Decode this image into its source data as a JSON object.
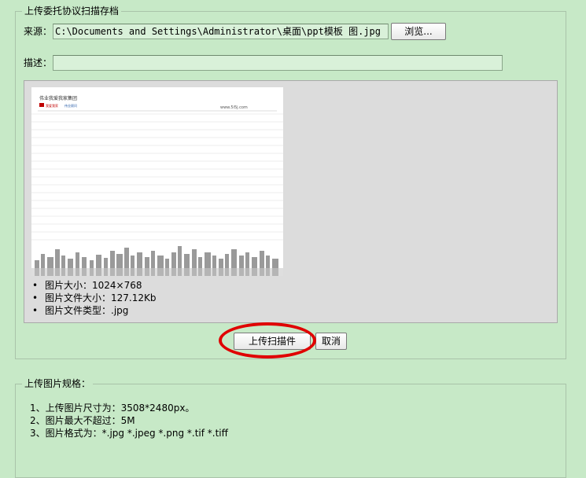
{
  "upload_section": {
    "legend": "上传委托协议扫描存档",
    "source_label": "来源：",
    "source_value": "C:\\Documents and Settings\\Administrator\\桌面\\ppt模板 图.jpg",
    "browse_label": "浏览...",
    "desc_label": "描述：",
    "desc_value": "",
    "preview": {
      "thumbnail": {
        "logo_text": "伟业我爱我家集团",
        "brand_left": "我爱我家",
        "brand_right": "伟业顾问",
        "url_text": "www.5i5j.com"
      },
      "info": [
        "图片大小：1024×768",
        "图片文件大小：127.12Kb",
        "图片文件类型：.jpg"
      ]
    },
    "upload_button": "上传扫描件",
    "cancel_button": "取消",
    "highlight_color": "#e00000"
  },
  "spec_section": {
    "legend": "上传图片规格：",
    "items": [
      "1、上传图片尺寸为：3508*2480px。",
      "2、图片最大不超过：5M",
      "3、图片格式为：*.jpg *.jpeg *.png *.tif *.tiff"
    ]
  }
}
